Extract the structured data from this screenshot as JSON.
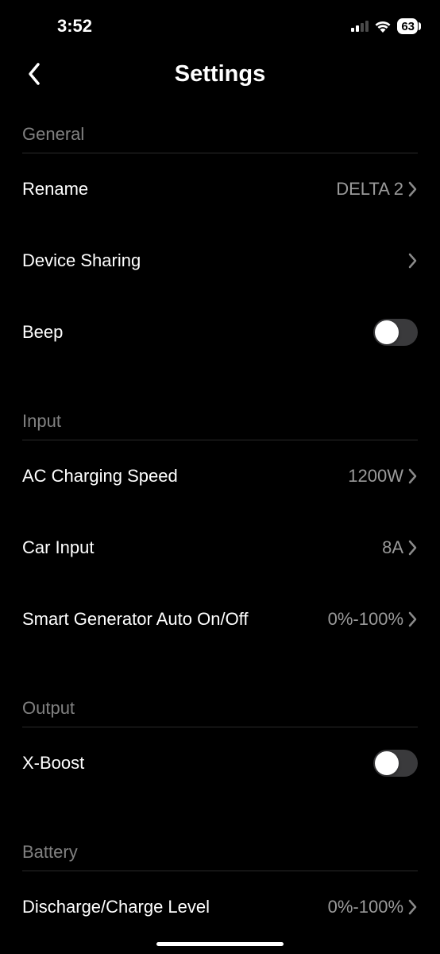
{
  "status": {
    "time": "3:52",
    "battery": "63"
  },
  "header": {
    "title": "Settings"
  },
  "sections": {
    "general": {
      "title": "General",
      "rename_label": "Rename",
      "rename_value": "DELTA 2",
      "device_sharing_label": "Device Sharing",
      "beep_label": "Beep"
    },
    "input": {
      "title": "Input",
      "ac_label": "AC Charging Speed",
      "ac_value": "1200W",
      "car_label": "Car Input",
      "car_value": "8A",
      "smart_gen_label": "Smart Generator Auto On/Off",
      "smart_gen_value": "0%-100%"
    },
    "output": {
      "title": "Output",
      "xboost_label": "X-Boost"
    },
    "battery": {
      "title": "Battery",
      "discharge_label": "Discharge/Charge Level",
      "discharge_value": "0%-100%"
    }
  }
}
